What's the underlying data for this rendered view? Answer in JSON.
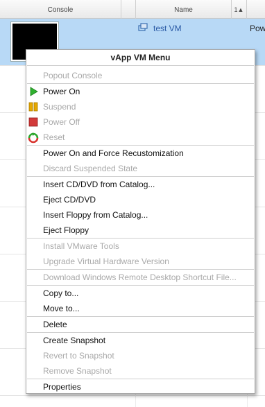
{
  "grid": {
    "columns": [
      "Console",
      "Name",
      "1▲"
    ],
    "row": {
      "name": "test VM",
      "status_partial": "Pow"
    }
  },
  "menu": {
    "title": "vApp VM Menu",
    "items": [
      {
        "label": "Popout Console",
        "enabled": false,
        "icon": null
      },
      {
        "label": "Power On",
        "enabled": true,
        "icon": "play-icon"
      },
      {
        "label": "Suspend",
        "enabled": false,
        "icon": "pause-icon"
      },
      {
        "label": "Power Off",
        "enabled": false,
        "icon": "stop-icon"
      },
      {
        "label": "Reset",
        "enabled": false,
        "icon": "reset-icon"
      },
      {
        "label": "Power On and Force Recustomization",
        "enabled": true,
        "icon": null
      },
      {
        "label": "Discard Suspended State",
        "enabled": false,
        "icon": null
      },
      {
        "label": "Insert CD/DVD from Catalog...",
        "enabled": true,
        "icon": null
      },
      {
        "label": "Eject CD/DVD",
        "enabled": true,
        "icon": null
      },
      {
        "label": "Insert Floppy from Catalog...",
        "enabled": true,
        "icon": null
      },
      {
        "label": "Eject Floppy",
        "enabled": true,
        "icon": null
      },
      {
        "label": "Install VMware Tools",
        "enabled": false,
        "icon": null
      },
      {
        "label": "Upgrade Virtual Hardware Version",
        "enabled": false,
        "icon": null
      },
      {
        "label": "Download Windows Remote Desktop Shortcut File...",
        "enabled": false,
        "icon": null
      },
      {
        "label": "Copy to...",
        "enabled": true,
        "icon": null
      },
      {
        "label": "Move to...",
        "enabled": true,
        "icon": null
      },
      {
        "label": "Delete",
        "enabled": true,
        "icon": null
      },
      {
        "label": "Create Snapshot",
        "enabled": true,
        "icon": null
      },
      {
        "label": "Revert to Snapshot",
        "enabled": false,
        "icon": null
      },
      {
        "label": "Remove Snapshot",
        "enabled": false,
        "icon": null
      },
      {
        "label": "Properties",
        "enabled": true,
        "icon": null
      }
    ]
  },
  "colors": {
    "selected_row": "#b8d9f6",
    "link": "#2a5aa5",
    "disabled_text": "#a9a9a9",
    "play": "#2fb12f",
    "pause": "#e6a800",
    "stop": "#d23a3a"
  }
}
